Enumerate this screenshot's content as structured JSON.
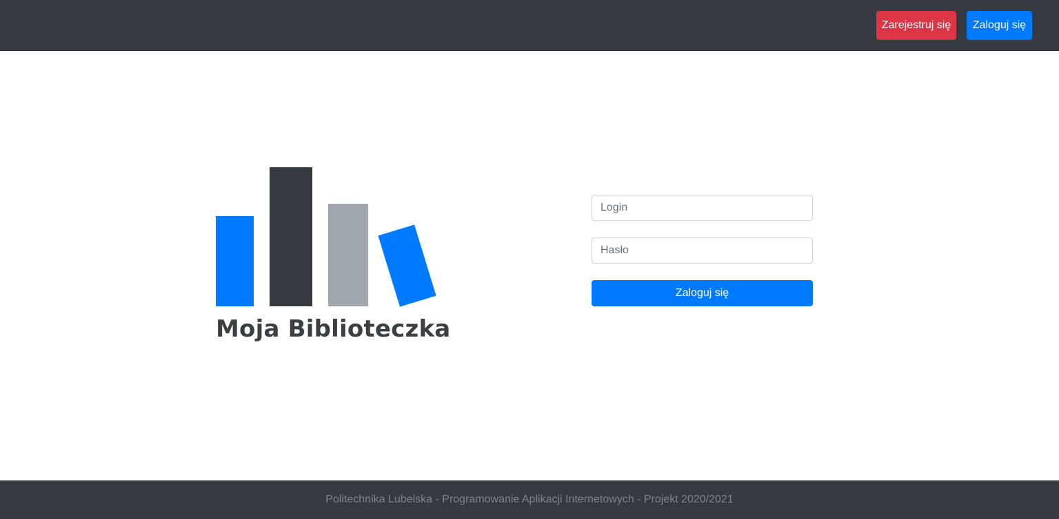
{
  "navbar": {
    "register_label": "Zarejestruj się",
    "login_label": "Zaloguj się"
  },
  "logo": {
    "text": "Moja Biblioteczka",
    "colors": [
      "#007bff",
      "#343a40",
      "#a1a8ad",
      "#007bff"
    ]
  },
  "login_form": {
    "login_placeholder": "Login",
    "password_placeholder": "Hasło",
    "submit_label": "Zaloguj się"
  },
  "footer": {
    "text": "Politechnika Lubelska - Programowanie Aplikacji Internetowych - Projekt 2020/2021"
  },
  "colors": {
    "navbar_bg": "#343a40",
    "primary": "#007bff",
    "danger": "#dc3545"
  }
}
